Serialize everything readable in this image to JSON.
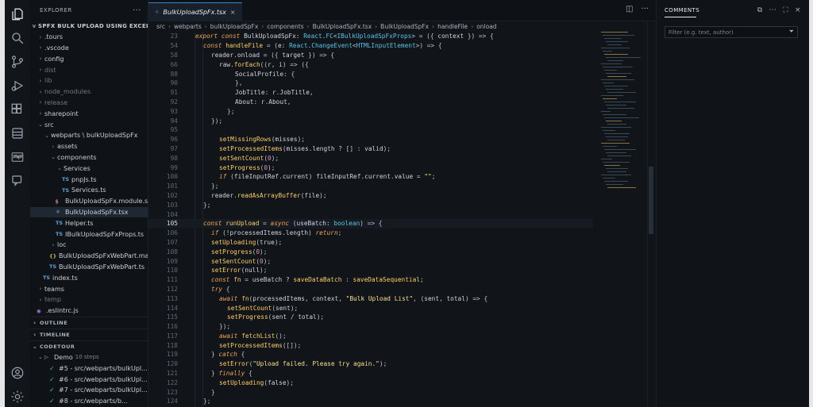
{
  "activity_bar": {
    "icons": [
      "files-icon",
      "search-icon",
      "source-control-icon",
      "run-debug-icon",
      "extensions-icon",
      "database-icon",
      "pnp-icon",
      "remote-chat-icon",
      "account-icon",
      "settings-gear-icon"
    ]
  },
  "sidebar": {
    "header": "EXPLORER",
    "project_title": "SPFX BULK UPLOAD USING EXCEL",
    "tree": [
      {
        "label": ".tours",
        "caret": ">",
        "indent": 1,
        "type": "folder"
      },
      {
        "label": ".vscode",
        "caret": ">",
        "indent": 1,
        "type": "folder"
      },
      {
        "label": "config",
        "caret": ">",
        "indent": 1,
        "type": "folder"
      },
      {
        "label": "dist",
        "caret": ">",
        "indent": 1,
        "type": "folder",
        "dim": true
      },
      {
        "label": "lib",
        "caret": ">",
        "indent": 1,
        "type": "folder",
        "dim": true
      },
      {
        "label": "node_modules",
        "caret": ">",
        "indent": 1,
        "type": "folder",
        "dim": true
      },
      {
        "label": "release",
        "caret": ">",
        "indent": 1,
        "type": "folder",
        "dim": true
      },
      {
        "label": "sharepoint",
        "caret": ">",
        "indent": 1,
        "type": "folder"
      },
      {
        "label": "src",
        "caret": "v",
        "indent": 1,
        "type": "folder"
      },
      {
        "label": "webparts \\ bulkUploadSpFx",
        "caret": "v",
        "indent": 2,
        "type": "folder"
      },
      {
        "label": "assets",
        "caret": ">",
        "indent": 3,
        "type": "folder"
      },
      {
        "label": "components",
        "caret": "v",
        "indent": 3,
        "type": "folder"
      },
      {
        "label": "Services",
        "caret": "v",
        "indent": 4,
        "type": "folder"
      },
      {
        "label": "pnpJs.ts",
        "icon": "TS",
        "indent": 5,
        "type": "ts"
      },
      {
        "label": "Services.ts",
        "icon": "TS",
        "indent": 5,
        "type": "ts"
      },
      {
        "label": "BulkUploadSpFx.module.scss",
        "icon": "§",
        "indent": 4,
        "type": "scss"
      },
      {
        "label": "BulkUploadSpFx.tsx",
        "icon": "⚛",
        "indent": 4,
        "type": "jsx",
        "selected": true
      },
      {
        "label": "Helper.ts",
        "icon": "TS",
        "indent": 4,
        "type": "ts"
      },
      {
        "label": "IBulkUploadSpFxProps.ts",
        "icon": "TS",
        "indent": 4,
        "type": "ts"
      },
      {
        "label": "loc",
        "caret": ">",
        "indent": 3,
        "type": "folder"
      },
      {
        "label": "BulkUploadSpFxWebPart.manif...",
        "icon": "{}",
        "indent": 3,
        "type": "json"
      },
      {
        "label": "BulkUploadSpFxWebPart.ts",
        "icon": "TS",
        "indent": 3,
        "type": "ts"
      },
      {
        "label": "index.ts",
        "icon": "TS",
        "indent": 2,
        "type": "ts"
      },
      {
        "label": "teams",
        "caret": ">",
        "indent": 1,
        "type": "folder"
      },
      {
        "label": "temp",
        "caret": ">",
        "indent": 1,
        "type": "folder",
        "dim": true
      },
      {
        "label": ".eslintrc.js",
        "icon": "◉",
        "indent": 1,
        "type": "eslint"
      }
    ],
    "sections": [
      "OUTLINE",
      "TIMELINE",
      "CODETOUR"
    ],
    "codetour": {
      "tour_label": "Demo",
      "tour_steps": "10 steps",
      "steps": [
        {
          "label": "#5 - src/webparts/bulkUpl..."
        },
        {
          "label": "#6 - src/webparts/bulkUpl..."
        },
        {
          "label": "#7 - src/webparts/bulkUpl..."
        },
        {
          "label": "#8 - src/webparts/b..."
        }
      ]
    }
  },
  "editor": {
    "tab_label": "BulkUploadSpFx.tsx",
    "tab_icon": "TS",
    "breadcrumb": [
      "src",
      "webparts",
      "bulkUploadSpFx",
      "components",
      "BulkUploadSpFx.tsx",
      "BulkUploadSpFx",
      "handleFile",
      "onload"
    ],
    "lines": [
      {
        "n": "23",
        "indent": 1,
        "text": "export const BulkUploadSpFx: React.FC<IBulkUploadSpFxProps> = ({ context }) => {"
      },
      {
        "n": "54",
        "indent": 2,
        "text": "const handleFile = (e: React.ChangeEvent<HTMLInputElement>) => {"
      },
      {
        "n": "58",
        "indent": 3,
        "text": "reader.onload = ({ target }) => {"
      },
      {
        "n": "66",
        "indent": 4,
        "text": "raw.forEach((r, i) => ({"
      },
      {
        "n": "88",
        "indent": 6,
        "text": "SocialProfile: {"
      },
      {
        "n": "90",
        "indent": 6,
        "text": "},"
      },
      {
        "n": "91",
        "indent": 6,
        "text": "JobTitle: r.JobTitle,"
      },
      {
        "n": "92",
        "indent": 6,
        "text": "About: r.About,"
      },
      {
        "n": "93",
        "indent": 5,
        "text": "};"
      },
      {
        "n": "94",
        "indent": 3,
        "text": "});"
      },
      {
        "n": "95",
        "indent": 0,
        "text": ""
      },
      {
        "n": "96",
        "indent": 4,
        "text": "setMissingRows(misses);"
      },
      {
        "n": "97",
        "indent": 4,
        "text": "setProcessedItems(misses.length ? [] : valid);"
      },
      {
        "n": "98",
        "indent": 4,
        "text": "setSentCount(0);"
      },
      {
        "n": "99",
        "indent": 4,
        "text": "setProgress(0);"
      },
      {
        "n": "100",
        "indent": 4,
        "text": "if (fileInputRef.current) fileInputRef.current.value = \"\";"
      },
      {
        "n": "101",
        "indent": 3,
        "text": "};"
      },
      {
        "n": "102",
        "indent": 3,
        "text": "reader.readAsArrayBuffer(file);"
      },
      {
        "n": "103",
        "indent": 2,
        "text": "};"
      },
      {
        "n": "104",
        "indent": 0,
        "text": ""
      },
      {
        "n": "105",
        "indent": 2,
        "text": "const runUpload = async (useBatch: boolean) => {",
        "current": true
      },
      {
        "n": "106",
        "indent": 3,
        "text": "if (!processedItems.length) return;"
      },
      {
        "n": "107",
        "indent": 3,
        "text": "setUploading(true);"
      },
      {
        "n": "108",
        "indent": 3,
        "text": "setProgress(0);"
      },
      {
        "n": "109",
        "indent": 3,
        "text": "setSentCount(0);"
      },
      {
        "n": "110",
        "indent": 3,
        "text": "setError(null);"
      },
      {
        "n": "111",
        "indent": 3,
        "text": "const fn = useBatch ? saveDataBatch : saveDataSequential;"
      },
      {
        "n": "112",
        "indent": 3,
        "text": "try {"
      },
      {
        "n": "113",
        "indent": 4,
        "text": "await fn(processedItems, context, \"Bulk Upload List\", (sent, total) => {"
      },
      {
        "n": "114",
        "indent": 5,
        "text": "setSentCount(sent);"
      },
      {
        "n": "115",
        "indent": 5,
        "text": "setProgress(sent / total);"
      },
      {
        "n": "116",
        "indent": 4,
        "text": "});"
      },
      {
        "n": "117",
        "indent": 4,
        "text": "await fetchList();"
      },
      {
        "n": "118",
        "indent": 4,
        "text": "setProcessedItems([]);"
      },
      {
        "n": "119",
        "indent": 3,
        "text": "} catch {"
      },
      {
        "n": "120",
        "indent": 4,
        "text": "setError(\"Upload failed. Please try again.\");"
      },
      {
        "n": "121",
        "indent": 3,
        "text": "} finally {"
      },
      {
        "n": "122",
        "indent": 4,
        "text": "setUploading(false);"
      },
      {
        "n": "123",
        "indent": 3,
        "text": "}"
      },
      {
        "n": "124",
        "indent": 2,
        "text": "};"
      }
    ]
  },
  "comments_panel": {
    "title": "COMMENTS",
    "filter_placeholder": "Filter (e.g. text, author)"
  },
  "colors": {
    "keyword": "#f0a35a",
    "function": "#ffcf6b",
    "string": "#f7e08a",
    "type": "#59c4e6",
    "text": "#cfd6dd",
    "accent": "#3a86d8"
  }
}
